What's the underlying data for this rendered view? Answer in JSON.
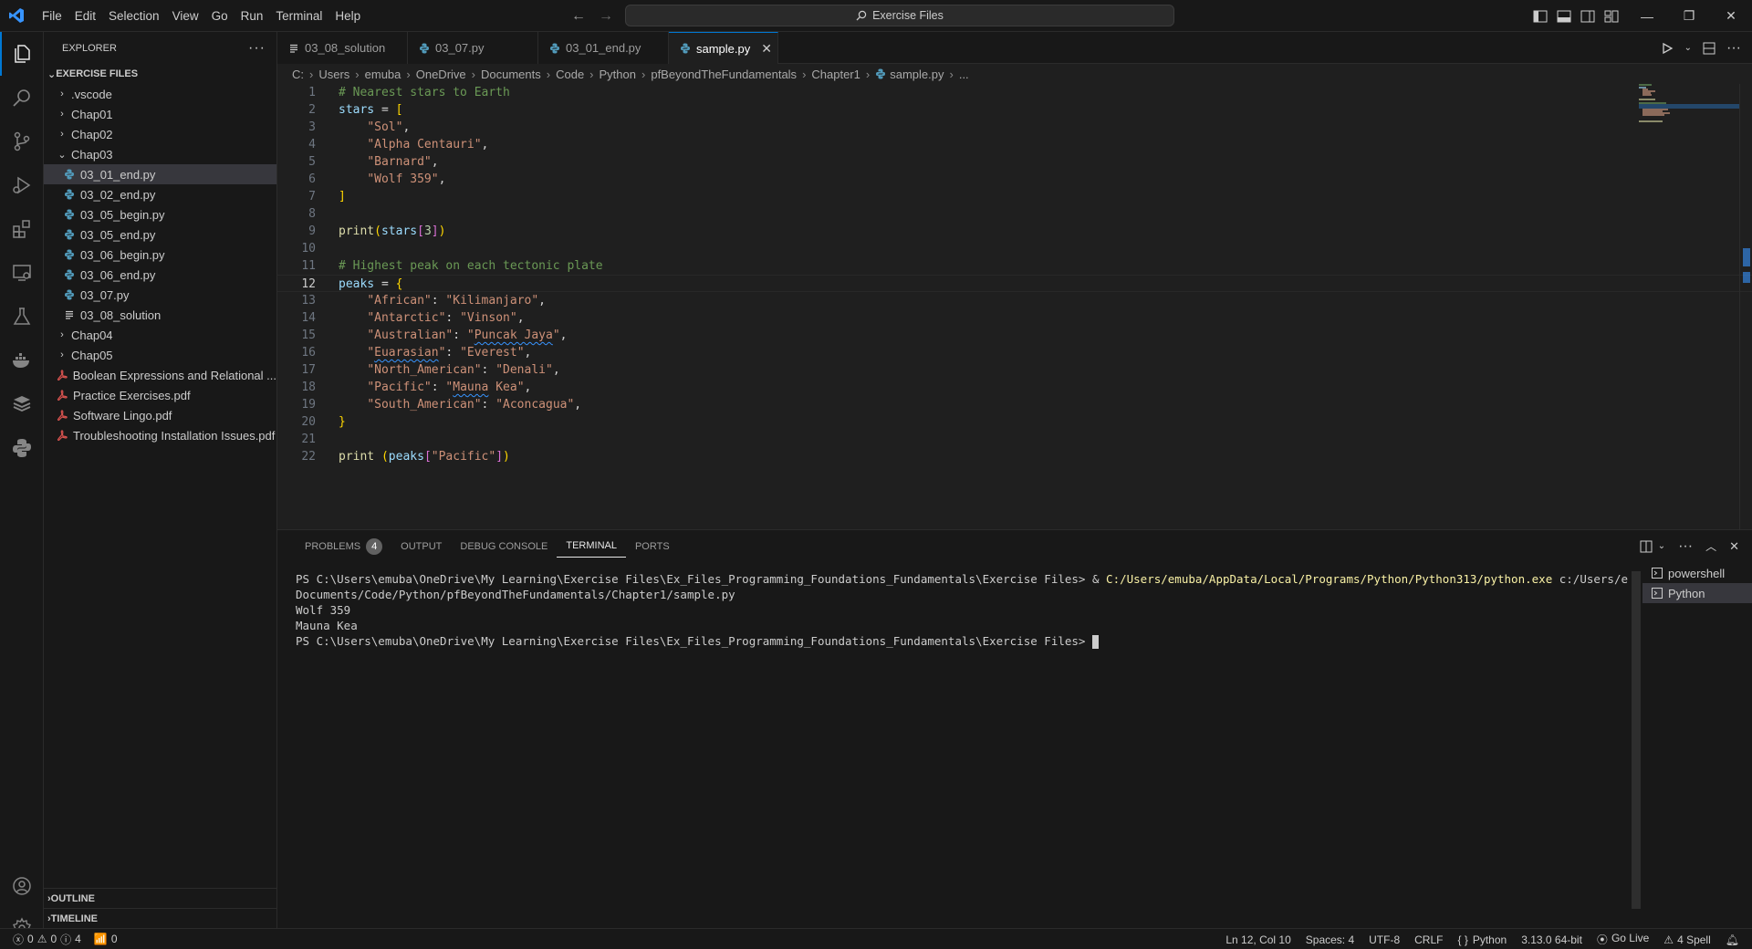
{
  "titlebar": {
    "menu": [
      "File",
      "Edit",
      "Selection",
      "View",
      "Go",
      "Run",
      "Terminal",
      "Help"
    ],
    "search_text": "Exercise Files"
  },
  "sidebar": {
    "header": "EXPLORER",
    "root": "EXERCISE FILES",
    "items": [
      {
        "label": ".vscode",
        "kind": "folder",
        "depth": 1,
        "expanded": false
      },
      {
        "label": "Chap01",
        "kind": "folder",
        "depth": 1,
        "expanded": false
      },
      {
        "label": "Chap02",
        "kind": "folder",
        "depth": 1,
        "expanded": false
      },
      {
        "label": "Chap03",
        "kind": "folder",
        "depth": 1,
        "expanded": true
      },
      {
        "label": "03_01_end.py",
        "kind": "py",
        "depth": 2,
        "selected": true
      },
      {
        "label": "03_02_end.py",
        "kind": "py",
        "depth": 2
      },
      {
        "label": "03_05_begin.py",
        "kind": "py",
        "depth": 2
      },
      {
        "label": "03_05_end.py",
        "kind": "py",
        "depth": 2
      },
      {
        "label": "03_06_begin.py",
        "kind": "py",
        "depth": 2
      },
      {
        "label": "03_06_end.py",
        "kind": "py",
        "depth": 2
      },
      {
        "label": "03_07.py",
        "kind": "py",
        "depth": 2
      },
      {
        "label": "03_08_solution",
        "kind": "txt",
        "depth": 2
      },
      {
        "label": "Chap04",
        "kind": "folder",
        "depth": 1,
        "expanded": false
      },
      {
        "label": "Chap05",
        "kind": "folder",
        "depth": 1,
        "expanded": false
      },
      {
        "label": "Boolean Expressions and Relational ...",
        "kind": "pdf",
        "depth": 1
      },
      {
        "label": "Practice Exercises.pdf",
        "kind": "pdf",
        "depth": 1
      },
      {
        "label": "Software Lingo.pdf",
        "kind": "pdf",
        "depth": 1
      },
      {
        "label": "Troubleshooting Installation Issues.pdf",
        "kind": "pdf",
        "depth": 1
      }
    ],
    "outline": "OUTLINE",
    "timeline": "TIMELINE"
  },
  "tabs": [
    {
      "label": "03_08_solution",
      "kind": "txt"
    },
    {
      "label": "03_07.py",
      "kind": "py"
    },
    {
      "label": "03_01_end.py",
      "kind": "py"
    },
    {
      "label": "sample.py",
      "kind": "py",
      "active": true
    }
  ],
  "breadcrumb": [
    "C:",
    "Users",
    "emuba",
    "OneDrive",
    "Documents",
    "Code",
    "Python",
    "pfBeyondTheFundamentals",
    "Chapter1",
    "sample.py",
    "..."
  ],
  "editor": {
    "current_line": 12,
    "lines": [
      [
        [
          "c-com",
          "# Nearest stars to Earth"
        ]
      ],
      [
        [
          "c-var",
          "stars"
        ],
        [
          "c-op",
          " = "
        ],
        [
          "c-br1",
          "["
        ]
      ],
      [
        [
          "c-op",
          "    "
        ],
        [
          "c-str",
          "\"Sol\""
        ],
        [
          "c-op",
          ","
        ]
      ],
      [
        [
          "c-op",
          "    "
        ],
        [
          "c-str",
          "\"Alpha Centauri\""
        ],
        [
          "c-op",
          ","
        ]
      ],
      [
        [
          "c-op",
          "    "
        ],
        [
          "c-str",
          "\"Barnard\""
        ],
        [
          "c-op",
          ","
        ]
      ],
      [
        [
          "c-op",
          "    "
        ],
        [
          "c-str",
          "\"Wolf 359\""
        ],
        [
          "c-op",
          ","
        ]
      ],
      [
        [
          "c-br1",
          "]"
        ]
      ],
      [],
      [
        [
          "c-fn",
          "print"
        ],
        [
          "c-br1",
          "("
        ],
        [
          "c-var",
          "stars"
        ],
        [
          "c-br2",
          "["
        ],
        [
          "c-num",
          "3"
        ],
        [
          "c-br2",
          "]"
        ],
        [
          "c-br1",
          ")"
        ]
      ],
      [],
      [
        [
          "c-com",
          "# Highest peak on each tectonic plate"
        ]
      ],
      [
        [
          "c-var",
          "peaks"
        ],
        [
          "c-op",
          " = "
        ],
        [
          "c-br1",
          "{"
        ]
      ],
      [
        [
          "c-op",
          "    "
        ],
        [
          "c-str",
          "\"African\""
        ],
        [
          "c-op",
          ": "
        ],
        [
          "c-str",
          "\"Kilimanjaro\""
        ],
        [
          "c-op",
          ","
        ]
      ],
      [
        [
          "c-op",
          "    "
        ],
        [
          "c-str",
          "\"Antarctic\""
        ],
        [
          "c-op",
          ": "
        ],
        [
          "c-str",
          "\"Vinson\""
        ],
        [
          "c-op",
          ","
        ]
      ],
      [
        [
          "c-op",
          "    "
        ],
        [
          "c-str",
          "\"Australian\""
        ],
        [
          "c-op",
          ": "
        ],
        [
          "c-str",
          "\"Puncak Jaya\""
        ],
        [
          "c-op",
          ","
        ]
      ],
      [
        [
          "c-op",
          "    "
        ],
        [
          "c-str",
          "\"Euarasian\""
        ],
        [
          "c-op",
          ": "
        ],
        [
          "c-str",
          "\"Everest\""
        ],
        [
          "c-op",
          ","
        ]
      ],
      [
        [
          "c-op",
          "    "
        ],
        [
          "c-str",
          "\"North_American\""
        ],
        [
          "c-op",
          ": "
        ],
        [
          "c-str",
          "\"Denali\""
        ],
        [
          "c-op",
          ","
        ]
      ],
      [
        [
          "c-op",
          "    "
        ],
        [
          "c-str",
          "\"Pacific\""
        ],
        [
          "c-op",
          ": "
        ],
        [
          "c-str",
          "\"Mauna Kea\""
        ],
        [
          "c-op",
          ","
        ]
      ],
      [
        [
          "c-op",
          "    "
        ],
        [
          "c-str",
          "\"South_American\""
        ],
        [
          "c-op",
          ": "
        ],
        [
          "c-str",
          "\"Aconcagua\""
        ],
        [
          "c-op",
          ","
        ]
      ],
      [
        [
          "c-br1",
          "}"
        ]
      ],
      [],
      [
        [
          "c-fn",
          "print"
        ],
        [
          "c-op",
          " "
        ],
        [
          "c-br1",
          "("
        ],
        [
          "c-var",
          "peaks"
        ],
        [
          "c-br2",
          "["
        ],
        [
          "c-str",
          "\"Pacific\""
        ],
        [
          "c-br2",
          "]"
        ],
        [
          "c-br1",
          ")"
        ]
      ]
    ]
  },
  "panel": {
    "tabs": [
      {
        "label": "PROBLEMS",
        "badge": "4"
      },
      {
        "label": "OUTPUT"
      },
      {
        "label": "DEBUG CONSOLE"
      },
      {
        "label": "TERMINAL",
        "active": true
      },
      {
        "label": "PORTS"
      }
    ],
    "terminal": {
      "prompt1": "PS C:\\Users\\emuba\\OneDrive\\My Learning\\Exercise Files\\Ex_Files_Programming_Foundations_Fundamentals\\Exercise Files> ",
      "amp": "& ",
      "exe": "C:/Users/emuba/AppData/Local/Programs/Python/Python313/python.exe",
      "arg1": " c:/Users/emuba/OneDrive/",
      "arg2": "Documents/Code/Python/pfBeyondTheFundamentals/Chapter1/sample.py",
      "out1": "Wolf 359",
      "out2": "Mauna Kea",
      "prompt2": "PS C:\\Users\\emuba\\OneDrive\\My Learning\\Exercise Files\\Ex_Files_Programming_Foundations_Fundamentals\\Exercise Files> "
    },
    "terminal_list": [
      {
        "label": "powershell"
      },
      {
        "label": "Python",
        "active": true
      }
    ]
  },
  "statusbar": {
    "errors": "0",
    "warnings": "0",
    "infos": "4",
    "ports": "0",
    "position": "Ln 12, Col 10",
    "spaces": "Spaces: 4",
    "encoding": "UTF-8",
    "eol": "CRLF",
    "language": "Python",
    "interpreter": "3.13.0 64-bit",
    "golive": "Go Live",
    "spell": "4 Spell"
  },
  "colors": {
    "accent": "#0078d4",
    "python_icon": "#519aba",
    "pdf_icon": "#d9534f",
    "terminal_path": "#f9f1a5"
  }
}
